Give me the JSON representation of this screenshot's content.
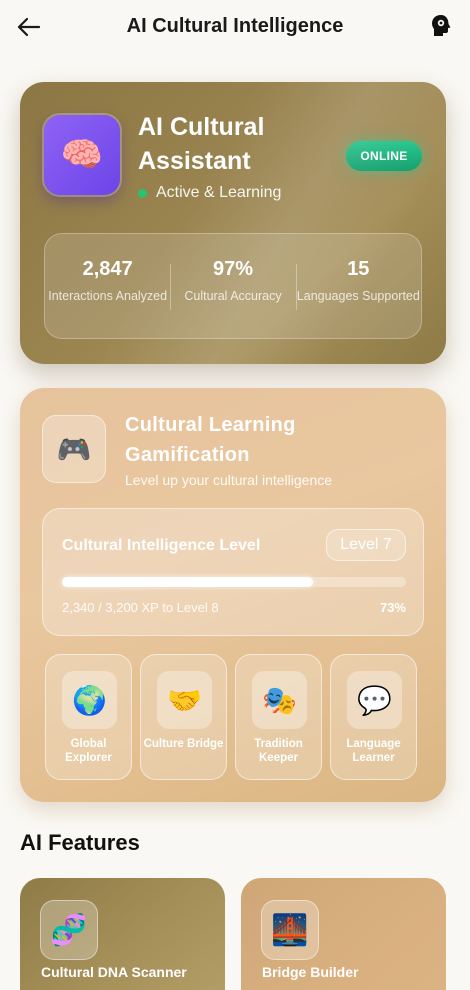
{
  "header": {
    "title": "AI Cultural Intelligence",
    "back_icon": "arrow-left-icon",
    "action_icon": "brain-head-icon"
  },
  "assistant": {
    "icon": "🧠",
    "title": "AI Cultural Assistant",
    "badge": "ONLINE",
    "status": "Active & Learning",
    "stats": [
      {
        "value": "2,847",
        "label": "Interactions Analyzed"
      },
      {
        "value": "97%",
        "label": "Cultural Accuracy"
      },
      {
        "value": "15",
        "label": "Languages Supported"
      }
    ]
  },
  "gamification": {
    "icon": "🎮",
    "title": "Cultural Learning Gamification",
    "subtitle": "Level up your cultural intelligence",
    "level_label": "Cultural Intelligence Level",
    "level_badge": "Level 7",
    "progress_fraction": 0.73,
    "xp_text": "2,340 / 3,200 XP to Level 8",
    "percent_text": "73%",
    "badges": [
      {
        "icon": "🌍",
        "label": "Global Explorer"
      },
      {
        "icon": "🤝",
        "label": "Culture Bridge"
      },
      {
        "icon": "🎭",
        "label": "Tradition Keeper"
      },
      {
        "icon": "💬",
        "label": "Language Learner"
      }
    ]
  },
  "features": {
    "heading": "AI Features",
    "items": [
      {
        "icon": "🧬",
        "label": "Cultural DNA Scanner"
      },
      {
        "icon": "🌉",
        "label": "Bridge Builder"
      }
    ]
  },
  "colors": {
    "online": "#1fb57f",
    "status_dot": "#27c46e",
    "brain_tile": "#7b52ef"
  }
}
